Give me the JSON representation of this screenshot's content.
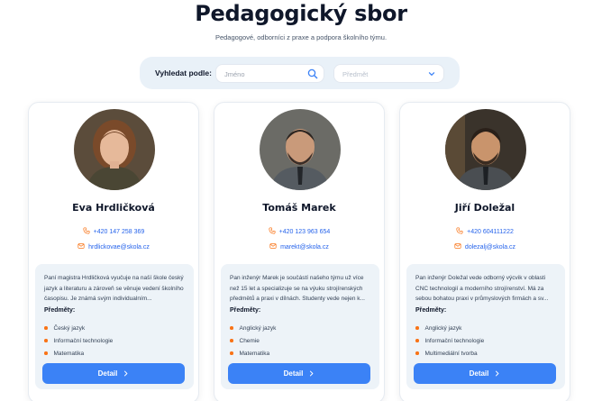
{
  "header": {
    "title": "Pedagogický sbor",
    "subtitle": "Pedagogové, odborníci z praxe a podpora školního týmu."
  },
  "search": {
    "label": "Vyhledat podle:",
    "name_placeholder": "Jméno",
    "subject_placeholder": "Předmět",
    "search_icon": "search-icon",
    "dropdown_icon": "chevron-down-icon"
  },
  "theme": {
    "accent": "#3b82f6",
    "link": "#2563eb",
    "bullet": "#f97316",
    "panel": "#edf3f8"
  },
  "teachers": [
    {
      "name": "Eva Hrdličková",
      "phone": "+420 147 258 369",
      "email": "hrdlickovae@skola.cz",
      "bio": "Paní magistra Hrdličková vyučuje na naší škole český jazyk a literaturu a zároveň se věnuje vedení školního časopisu. Je známá svým individualním...",
      "subjects_label": "Předměty:",
      "subjects": [
        "Český jazyk",
        "Informační technologie",
        "Matematika"
      ],
      "button": "Detail"
    },
    {
      "name": "Tomáš Marek",
      "phone": "+420 123 963 654",
      "email": "marekt@skola.cz",
      "bio": "Pan inženýr Marek je součástí našeho týmu už více než 15 let a specializuje se na výuku strojírenských předmětů a praxi v dílnách. Studenty vede nejen k...",
      "subjects_label": "Předměty:",
      "subjects": [
        "Anglický jazyk",
        "Chemie",
        "Matematika"
      ],
      "button": "Detail"
    },
    {
      "name": "Jiří Doležal",
      "phone": "+420 604111222",
      "email": "dolezalj@skola.cz",
      "bio": "Pan inženýr Doležal vede odborný výcvik v oblasti CNC technologií a moderního strojírenství. Má za sebou bohatou praxi v průmyslových firmách a sv...",
      "subjects_label": "Předměty:",
      "subjects": [
        "Anglický jazyk",
        "Informační technologie",
        "Multimediální tvorba"
      ],
      "button": "Detail"
    }
  ]
}
